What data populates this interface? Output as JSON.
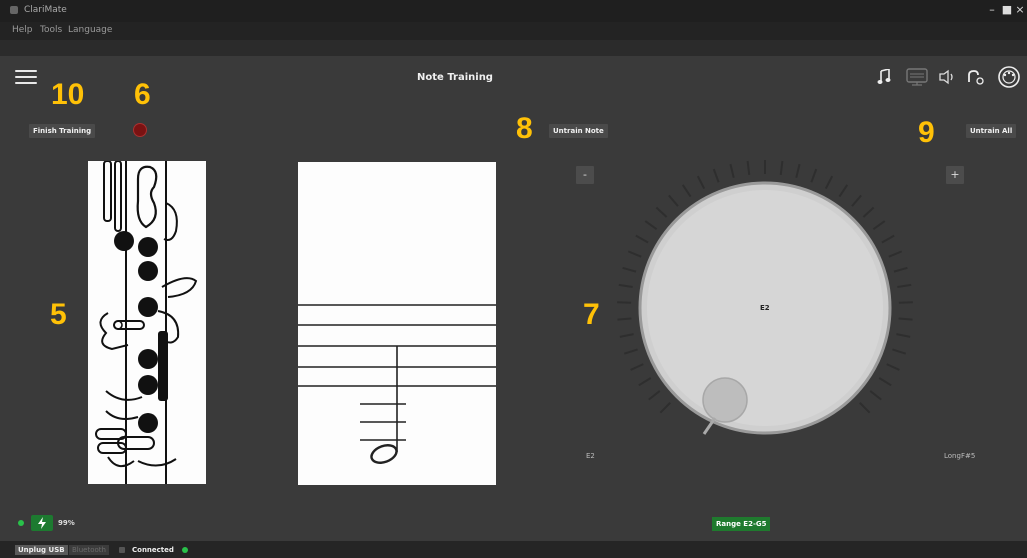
{
  "window": {
    "title": "ClariMate",
    "menu": [
      "Help",
      "Tools",
      "Language"
    ]
  },
  "header": {
    "page_title": "Note Training",
    "icons": [
      "music-note-icon",
      "keyboard-icon",
      "speaker-icon",
      "tuner-icon",
      "wind-controller-icon"
    ]
  },
  "controls": {
    "finish_training": "Finish Training",
    "untrain_note": "Untrain Note",
    "untrain_all": "Untrain All",
    "minus": "-",
    "plus": "+"
  },
  "annotations": {
    "n10": "10",
    "n6": "6",
    "n8": "8",
    "n9": "9",
    "n5": "5",
    "n7": "7"
  },
  "dial": {
    "current_note": "E2",
    "min_label": "E2",
    "max_label": "LongF#5"
  },
  "range_badge": "Range E2-G5",
  "battery": {
    "percent_label": "99%",
    "color": "#29c14a"
  },
  "status_bar": {
    "unplug_usb": "Unplug USB",
    "bluetooth": "Bluetooth",
    "connection": "Connected"
  },
  "colors": {
    "accent_number": "#ffc107",
    "background": "#3a3a3a",
    "green": "#29c14a",
    "range_badge": "#1f7a2e"
  }
}
